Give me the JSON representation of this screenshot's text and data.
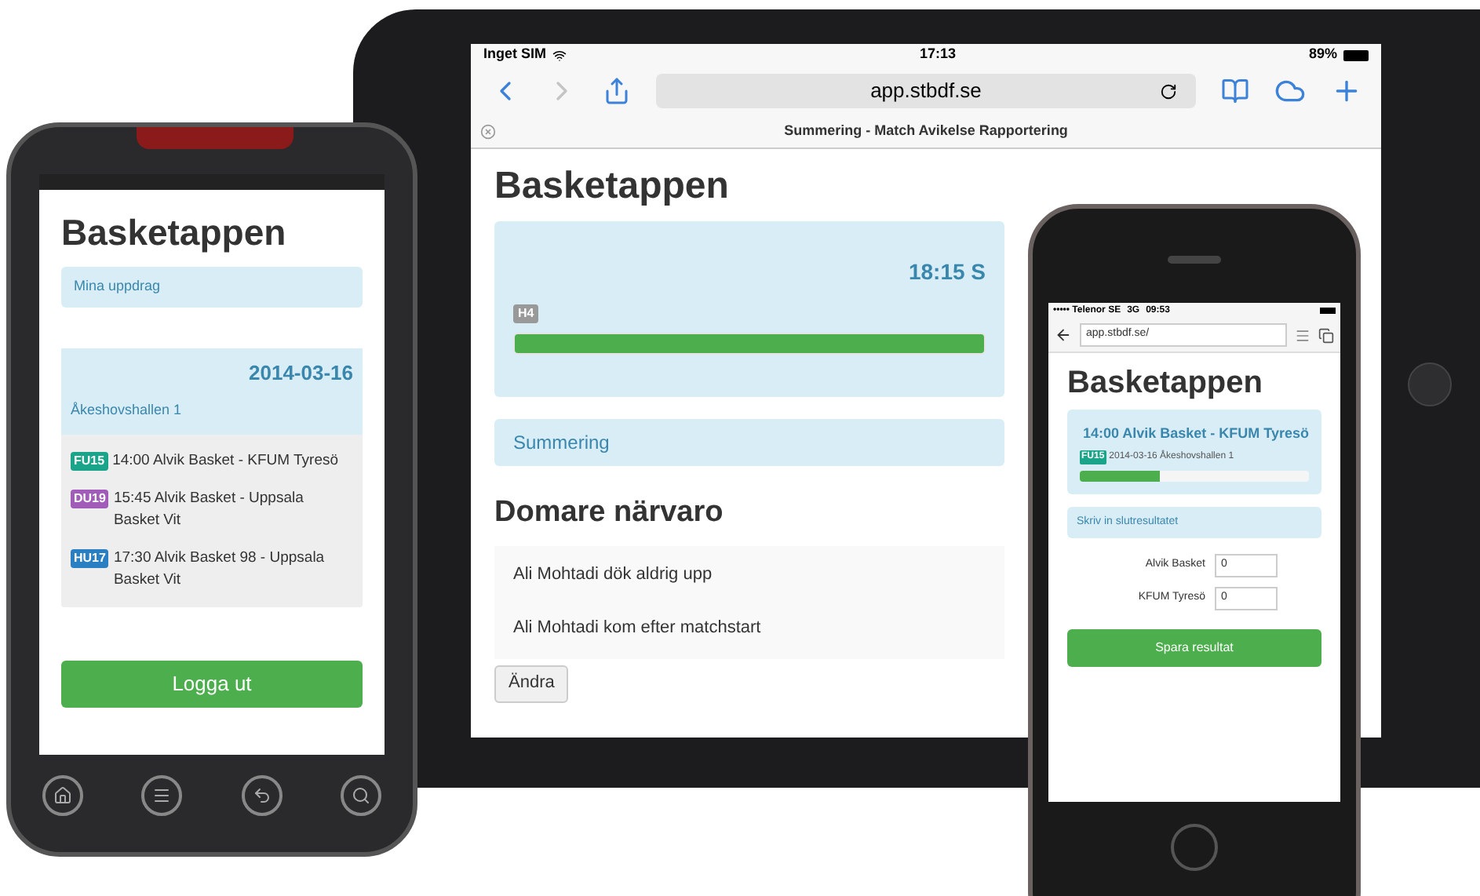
{
  "tablet": {
    "status_bar": {
      "carrier": "Inget SIM",
      "time": "17:13",
      "battery": "89%"
    },
    "browser": {
      "url": "app.stbdf.se",
      "tab_title": "Summering - Match Avikelse Rapportering"
    },
    "page": {
      "title": "Basketappen",
      "match_card": {
        "time": "18:15 S",
        "badge": "H4",
        "level": 1
      },
      "section": "Summering",
      "heading": "Domare närvaro",
      "list": [
        "Ali Mohtadi dök aldrig upp",
        "Ali Mohtadi kom efter matchstart"
      ],
      "button": "Ändra"
    }
  },
  "android_phone": {
    "title": "Basketappen",
    "nav": "Mina uppdrag",
    "date": "2014-03-16",
    "venue": "Åkeshovshallen 1",
    "matches": [
      {
        "badge": "FU15",
        "color": "#1aa58a",
        "text": "14:00 Alvik Basket - KFUM Tyresö"
      },
      {
        "badge": "DU19",
        "color": "#a05cb8",
        "text": "15:45 Alvik Basket - Uppsala Basket Vit"
      },
      {
        "badge": "HU17",
        "color": "#2a7ec2",
        "text": "17:30 Alvik Basket 98 - Uppsala Basket Vit"
      }
    ],
    "button": "Logga ut"
  },
  "iphone": {
    "status_bar": {
      "carrier": "••••• Telenor SE",
      "network": "3G",
      "time": "09:53"
    },
    "url": "app.stbdf.se/",
    "title": "Basketappen",
    "match": {
      "title": "14:00 Alvik Basket - KFUM Tyresö",
      "badge": "FU15",
      "color": "#1aa58a",
      "info": "2014-03-16 Åkeshovshallen 1",
      "level": 0.35
    },
    "section": "Skriv in slutresultatet",
    "scores": [
      {
        "team": "Alvik Basket",
        "value": "0"
      },
      {
        "team": "KFUM Tyresö",
        "value": "0"
      }
    ],
    "button": "Spara resultat"
  }
}
